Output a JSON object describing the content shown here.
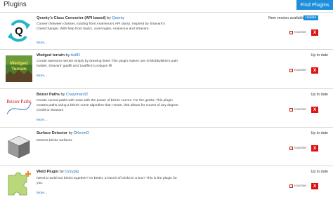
{
  "header": {
    "title": "Plugins",
    "find_button": "Find Plugins"
  },
  "plugins": [
    {
      "name": "Qeenty's Class Converter (API based)",
      "by": "by",
      "author": "Quenty",
      "description": "Convert between classes, loading from Anaminus's API dump. Inspired by Stravant's ClassChanger. With help from badcc, AxisAngles, Anaminus and Stravant.",
      "more": "More...",
      "status": "New version available",
      "update_label": "Update",
      "inactive_label": "Inactive",
      "remove_label": "X",
      "icon": "sync-q-icon"
    },
    {
      "name": "Wedged terrain",
      "by": "by",
      "author": "As8D",
      "description": "Create awesome terrain simply by drawing lines! This plugin makes use of BlobbyBlob's path builder, Stravant' gapfill and 1waffle1's polygon fill.",
      "more": "More...",
      "status": "Up to date",
      "inactive_label": "Inactive",
      "remove_label": "X",
      "icon_text": [
        "Wedged",
        "Terrain"
      ]
    },
    {
      "name": "Bézier Paths",
      "by": "by",
      "author": "Crazyman32",
      "description": "Create curved paths with ease with the power of bézier curves. For the geeks: This plugin creates paths using a bézier curve algorithm that I wrote, that allows for curves of any degree. Credit to Stravant",
      "more": "More...",
      "status": "Up to date",
      "inactive_label": "Inactive",
      "remove_label": "X",
      "icon_text": "Bézier Paths"
    },
    {
      "name": "Surface Detector",
      "by": "by",
      "author": "DKevinO",
      "description": "Detects bricks surfaces",
      "status": "Up to date",
      "inactive_label": "Inactive",
      "remove_label": "X",
      "icon": "brick-cube-icon"
    },
    {
      "name": "Weld Plugin",
      "by": "by",
      "author": "Ozzypig",
      "description": "Need to weld two bricks together? Or better, a bunch of bricks in a box? This is the plugin for you.",
      "more": "More...",
      "status": "Up to date",
      "inactive_label": "Inactive",
      "remove_label": "X",
      "icon": "puzzle-piece-icon"
    }
  ],
  "colors": {
    "accent": "#1e8edc",
    "remove": "#dd1111",
    "link": "#1b6fc7"
  }
}
